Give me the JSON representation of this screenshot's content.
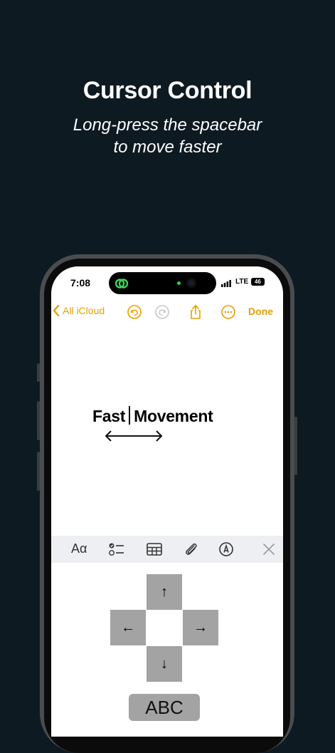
{
  "header": {
    "title": "Cursor Control",
    "subtitle_line1": "Long-press the spacebar",
    "subtitle_line2": "to move faster"
  },
  "status_bar": {
    "time": "7:08",
    "network": "LTE",
    "battery": "46"
  },
  "notes_toolbar": {
    "back_label": "All iCloud",
    "done_label": "Done",
    "icons": [
      "chevron-left-icon",
      "undo-icon",
      "redo-icon",
      "share-icon",
      "more-icon"
    ]
  },
  "note": {
    "word_before": "Fast",
    "word_after": "Movement"
  },
  "format_bar": {
    "aa_label": "Aα",
    "icons": [
      "checklist-icon",
      "table-icon",
      "paperclip-icon",
      "markup-icon",
      "close-icon"
    ]
  },
  "arrow_pad": {
    "up": "↑",
    "left": "←",
    "right": "→",
    "down": "↓",
    "abc_label": "ABC"
  },
  "colors": {
    "background": "#0e1a22",
    "accent": "#e5a000",
    "key": "#a3a3a3"
  }
}
